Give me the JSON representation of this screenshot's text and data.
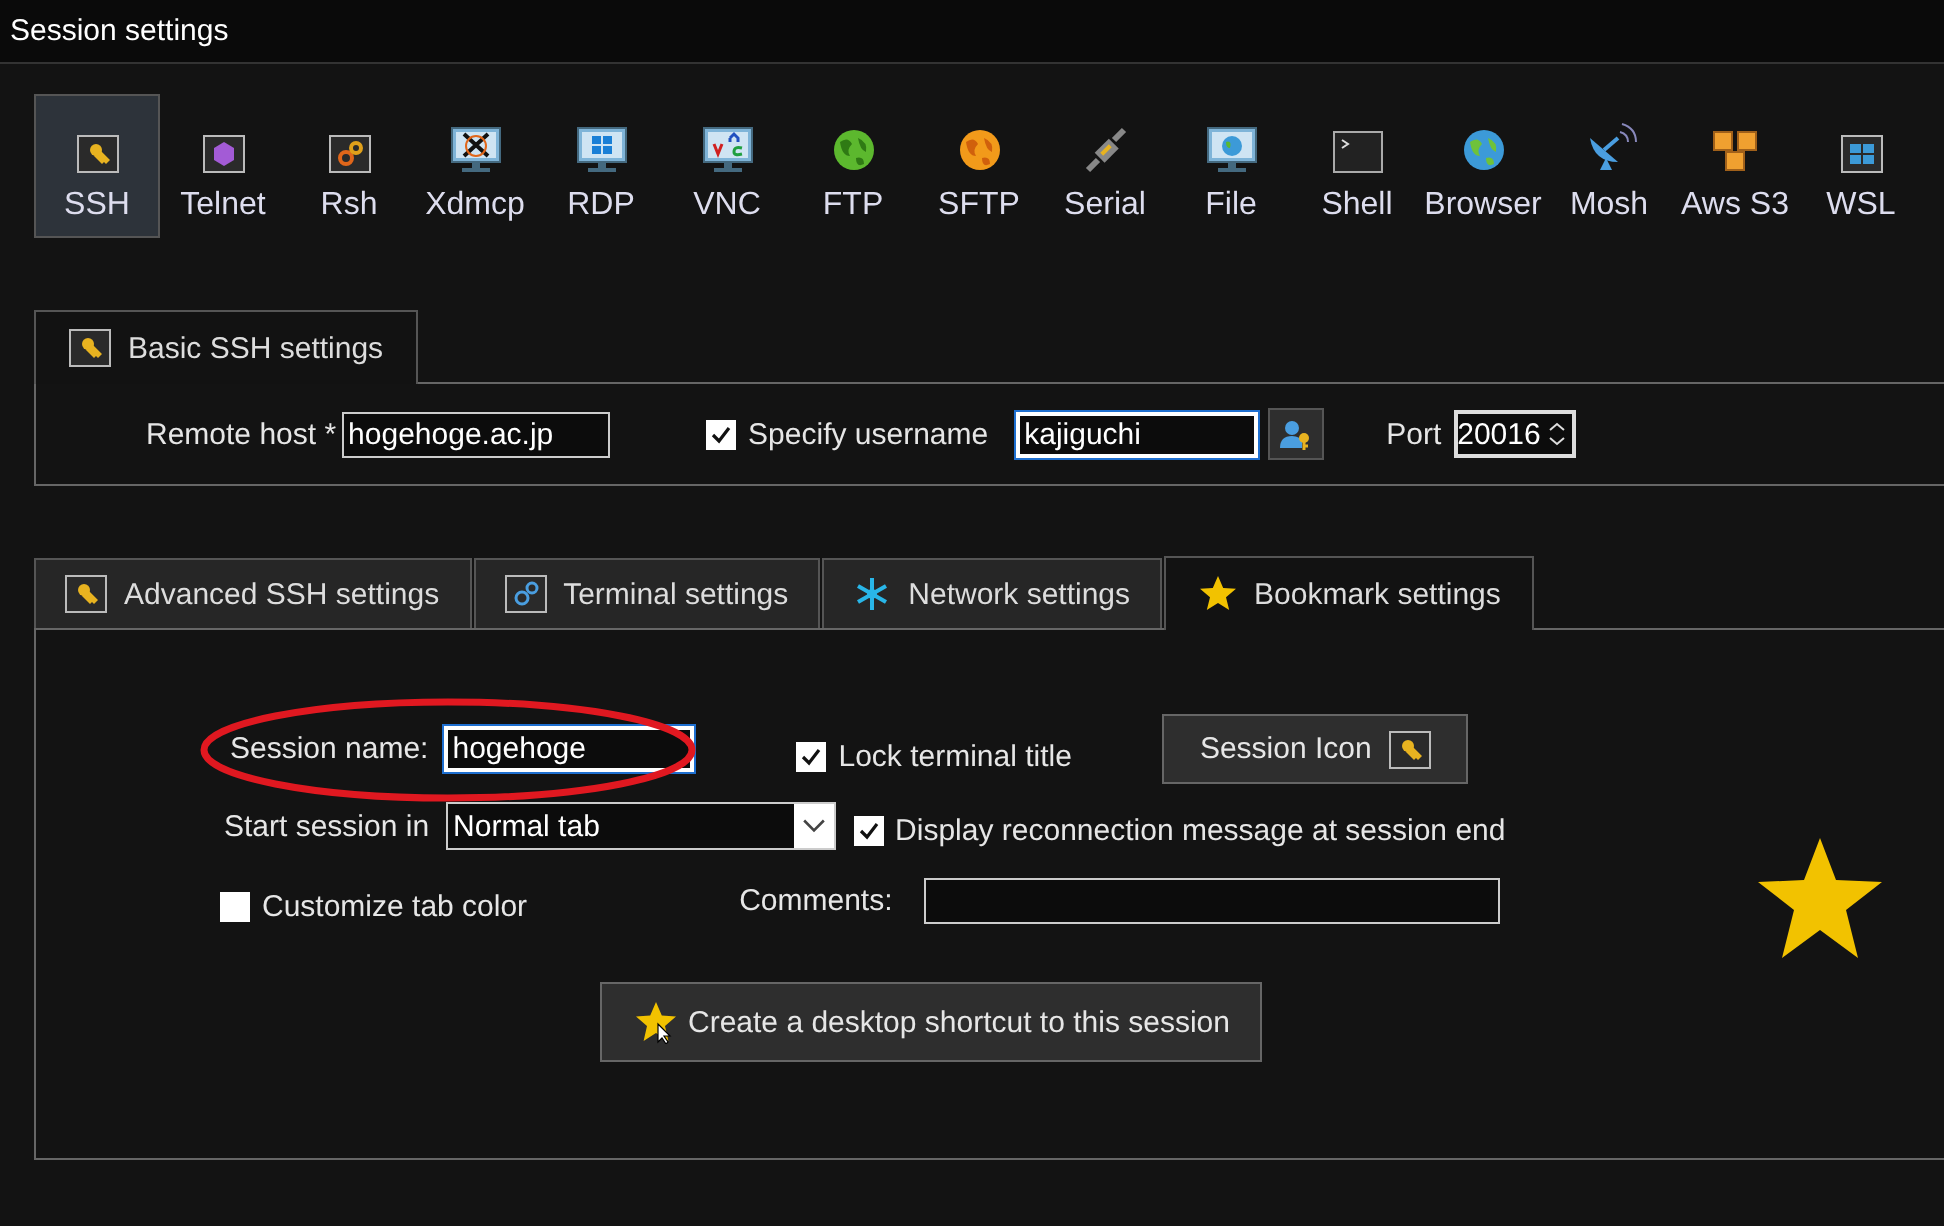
{
  "window": {
    "title": "Session settings"
  },
  "session_types": [
    {
      "label": "SSH",
      "selected": true
    },
    {
      "label": "Telnet",
      "selected": false
    },
    {
      "label": "Rsh",
      "selected": false
    },
    {
      "label": "Xdmcp",
      "selected": false
    },
    {
      "label": "RDP",
      "selected": false
    },
    {
      "label": "VNC",
      "selected": false
    },
    {
      "label": "FTP",
      "selected": false
    },
    {
      "label": "SFTP",
      "selected": false
    },
    {
      "label": "Serial",
      "selected": false
    },
    {
      "label": "File",
      "selected": false
    },
    {
      "label": "Shell",
      "selected": false
    },
    {
      "label": "Browser",
      "selected": false
    },
    {
      "label": "Mosh",
      "selected": false
    },
    {
      "label": "Aws S3",
      "selected": false
    },
    {
      "label": "WSL",
      "selected": false
    }
  ],
  "basic_tab": {
    "label": "Basic SSH settings"
  },
  "basic": {
    "remote_host_label": "Remote host *",
    "remote_host": "hogehoge.ac.jp",
    "specify_username": {
      "label": "Specify username",
      "checked": true
    },
    "username": "kajiguchi",
    "port_label": "Port",
    "port": "20016"
  },
  "tabs": [
    {
      "label": "Advanced SSH settings",
      "selected": false
    },
    {
      "label": "Terminal settings",
      "selected": false
    },
    {
      "label": "Network settings",
      "selected": false
    },
    {
      "label": "Bookmark settings",
      "selected": true
    }
  ],
  "bookmark": {
    "session_name_label": "Session name:",
    "session_name": "hogehoge",
    "lock_terminal_title": {
      "label": "Lock terminal title",
      "checked": true
    },
    "session_icon_button": "Session Icon",
    "start_session_label": "Start session in",
    "start_session_value": "Normal tab",
    "display_reconnection": {
      "label": "Display reconnection message at session end",
      "checked": true
    },
    "customize_tab_color": {
      "label": "Customize tab color",
      "checked": false
    },
    "comments_label": "Comments:",
    "shortcut_button": "Create a desktop shortcut to this session"
  }
}
